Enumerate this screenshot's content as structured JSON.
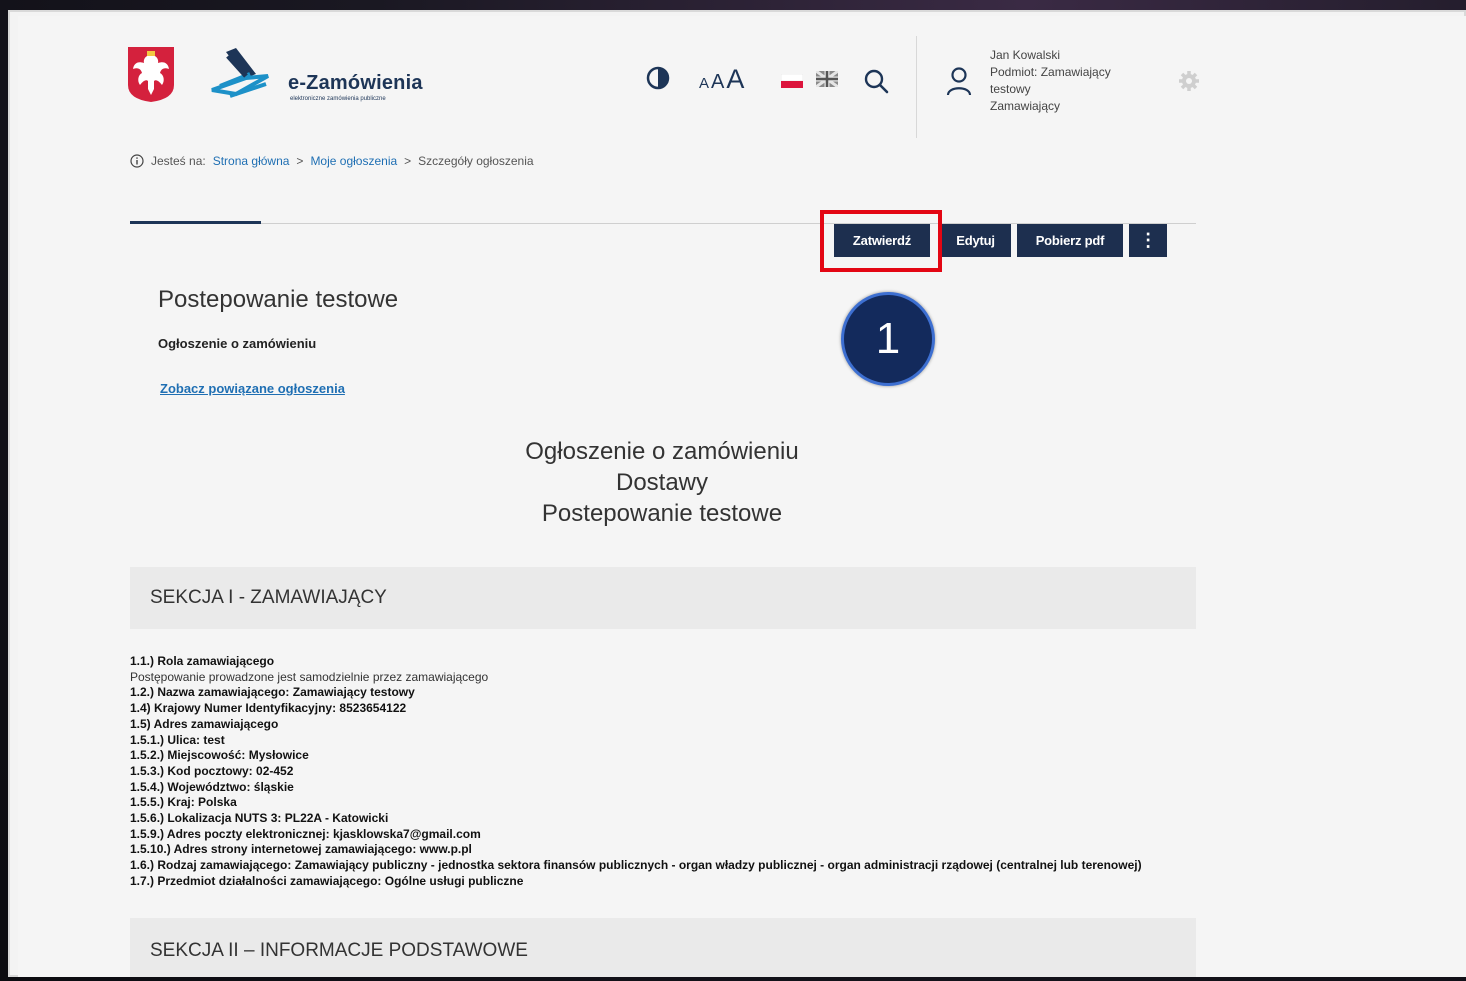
{
  "header": {
    "logo_title": "e-Zamówienia",
    "logo_subtitle": "elektroniczne zamówienia publiczne",
    "font_sizes": [
      "A",
      "A",
      "A"
    ],
    "user": {
      "name": "Jan Kowalski",
      "entity_line1": "Podmiot: Zamawiający",
      "entity_line2": "testowy",
      "role": "Zamawiający"
    }
  },
  "breadcrumb": {
    "prefix": "Jesteś na:",
    "items": [
      "Strona główna",
      "Moje ogłoszenia",
      "Szczegóły ogłoszenia"
    ],
    "separator": ">"
  },
  "toolbar": {
    "approve": "Zatwierdź",
    "edit": "Edytuj",
    "download_pdf": "Pobierz pdf",
    "more": "⋮"
  },
  "marker": {
    "number": "1"
  },
  "notice": {
    "title": "Postepowanie testowe",
    "type": "Ogłoszenie o zamówieniu",
    "related_link": "Zobacz powiązane ogłoszenia",
    "heading_line1": "Ogłoszenie o zamówieniu",
    "heading_line2": "Dostawy",
    "heading_line3": "Postepowanie testowe"
  },
  "sections": {
    "s1": "SEKCJA I - ZAMAWIAJĄCY",
    "s2": "SEKCJA II – INFORMACJE PODSTAWOWE"
  },
  "details": [
    {
      "label": "1.1.) Rola zamawiającego",
      "value": ""
    },
    {
      "label": "",
      "value": "Postępowanie prowadzone jest samodzielnie przez zamawiającego"
    },
    {
      "label": "1.2.) Nazwa zamawiającego:",
      "value": "Zamawiający testowy"
    },
    {
      "label": "1.4) Krajowy Numer Identyfikacyjny:",
      "value": "8523654122"
    },
    {
      "label": "1.5) Adres zamawiającego",
      "value": ""
    },
    {
      "label": "1.5.1.) Ulica:",
      "value": "test"
    },
    {
      "label": "1.5.2.) Miejscowość:",
      "value": "Mysłowice"
    },
    {
      "label": "1.5.3.) Kod pocztowy:",
      "value": "02-452"
    },
    {
      "label": "1.5.4.) Województwo:",
      "value": "śląskie"
    },
    {
      "label": "1.5.5.) Kraj:",
      "value": "Polska"
    },
    {
      "label": "1.5.6.) Lokalizacja NUTS 3:",
      "value": "PL22A - Katowicki"
    },
    {
      "label": "1.5.9.) Adres poczty elektronicznej:",
      "value": "kjasklowska7@gmail.com"
    },
    {
      "label": "1.5.10.) Adres strony internetowej zamawiającego:",
      "value": "www.p.pl"
    },
    {
      "label": "1.6.) Rodzaj zamawiającego:",
      "value": "Zamawiający publiczny - jednostka sektora finansów publicznych - organ władzy publicznej - organ administracji rządowej (centralnej lub terenowej)"
    },
    {
      "label": "1.7.) Przedmiot działalności zamawiającego:",
      "value": "Ogólne usługi publiczne"
    }
  ],
  "colors": {
    "navy": "#1d2f4f",
    "link": "#1f6fb3",
    "highlight": "#e30613",
    "marker": "#132a5c"
  }
}
